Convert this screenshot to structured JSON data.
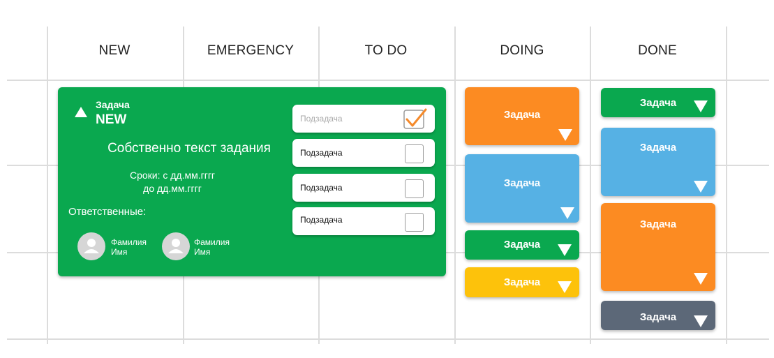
{
  "columns": [
    "NEW",
    "EMERGENCY",
    "TO DO",
    "DOING",
    "DONE"
  ],
  "colors": {
    "green": "#0aa84f",
    "orange": "#fc8b22",
    "blue": "#56b1e4",
    "yellow": "#fdc20b",
    "gray": "#5c6878",
    "check": "#f58a2b",
    "grid": "#dcdcdc"
  },
  "task_card": {
    "title": "Задача",
    "status": "NEW",
    "description": "Собственно текст задания",
    "deadline_line1": "Сроки: с дд.мм.гггг",
    "deadline_line2": "до дд.мм.гггг",
    "responsible_label": "Ответственные:",
    "people": [
      {
        "last_name": "Фамилия",
        "first_name": "Имя",
        "icon": "user-avatar-icon"
      },
      {
        "last_name": "Фамилия",
        "first_name": "Имя",
        "icon": "user-avatar-icon"
      }
    ],
    "subtasks": [
      {
        "label": "Подзадача",
        "checked": true
      },
      {
        "label": "Подзадача",
        "checked": false
      },
      {
        "label": "Подзадача",
        "checked": false
      },
      {
        "label": "Подзадача",
        "checked": false
      }
    ]
  },
  "doing_cards": [
    {
      "label": "Задача",
      "color": "orange"
    },
    {
      "label": "Задача",
      "color": "blue"
    },
    {
      "label": "Задача",
      "color": "green"
    },
    {
      "label": "Задача",
      "color": "yellow"
    }
  ],
  "done_cards": [
    {
      "label": "Задача",
      "color": "green"
    },
    {
      "label": "Задача",
      "color": "blue"
    },
    {
      "label": "Задача",
      "color": "orange"
    },
    {
      "label": "Задача",
      "color": "gray"
    }
  ]
}
